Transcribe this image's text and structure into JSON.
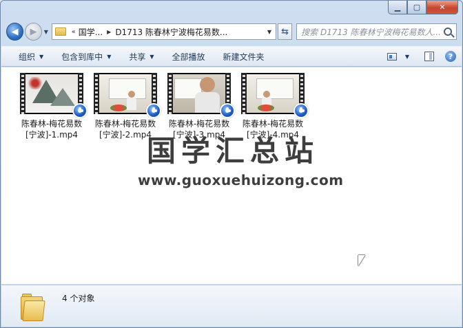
{
  "window": {
    "controls": {
      "minimize": "▁",
      "maximize": "▢",
      "close": "✕"
    }
  },
  "nav": {
    "back_glyph": "◀",
    "forward_glyph": "▶",
    "address": {
      "chevron": "«",
      "part1": "国学...",
      "part2": "D1713 陈春林宁波梅花易数..."
    },
    "refresh_glyph": "⇆",
    "search_placeholder": "搜索 D1713 陈春林宁波梅花易数人..."
  },
  "toolbar": {
    "organize": "组织",
    "include_in_library": "包含到库中",
    "share": "共享",
    "play_all": "全部播放",
    "new_folder": "新建文件夹",
    "help": "?"
  },
  "files": [
    {
      "name": "陈春林-梅花易数[宁波]-1.mp4"
    },
    {
      "name": "陈春林-梅花易数[宁波]-2.mp4"
    },
    {
      "name": "陈春林-梅花易数[宁波]-3.mp4"
    },
    {
      "name": "陈春林-梅花易数[宁波]-4.mp4"
    }
  ],
  "watermark": {
    "title": "国学汇总站",
    "url": "www.guoxuehuizong.com"
  },
  "details": {
    "count": "4 个对象"
  }
}
